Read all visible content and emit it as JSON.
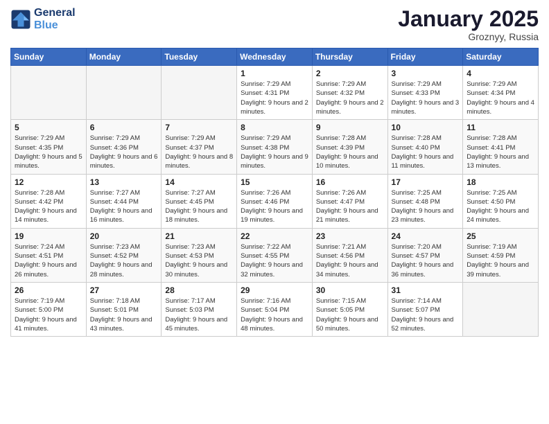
{
  "header": {
    "logo_line1": "General",
    "logo_line2": "Blue",
    "month": "January 2025",
    "location": "Groznyy, Russia"
  },
  "weekdays": [
    "Sunday",
    "Monday",
    "Tuesday",
    "Wednesday",
    "Thursday",
    "Friday",
    "Saturday"
  ],
  "weeks": [
    [
      {
        "day": "",
        "info": ""
      },
      {
        "day": "",
        "info": ""
      },
      {
        "day": "",
        "info": ""
      },
      {
        "day": "1",
        "info": "Sunrise: 7:29 AM\nSunset: 4:31 PM\nDaylight: 9 hours and 2 minutes."
      },
      {
        "day": "2",
        "info": "Sunrise: 7:29 AM\nSunset: 4:32 PM\nDaylight: 9 hours and 2 minutes."
      },
      {
        "day": "3",
        "info": "Sunrise: 7:29 AM\nSunset: 4:33 PM\nDaylight: 9 hours and 3 minutes."
      },
      {
        "day": "4",
        "info": "Sunrise: 7:29 AM\nSunset: 4:34 PM\nDaylight: 9 hours and 4 minutes."
      }
    ],
    [
      {
        "day": "5",
        "info": "Sunrise: 7:29 AM\nSunset: 4:35 PM\nDaylight: 9 hours and 5 minutes."
      },
      {
        "day": "6",
        "info": "Sunrise: 7:29 AM\nSunset: 4:36 PM\nDaylight: 9 hours and 6 minutes."
      },
      {
        "day": "7",
        "info": "Sunrise: 7:29 AM\nSunset: 4:37 PM\nDaylight: 9 hours and 8 minutes."
      },
      {
        "day": "8",
        "info": "Sunrise: 7:29 AM\nSunset: 4:38 PM\nDaylight: 9 hours and 9 minutes."
      },
      {
        "day": "9",
        "info": "Sunrise: 7:28 AM\nSunset: 4:39 PM\nDaylight: 9 hours and 10 minutes."
      },
      {
        "day": "10",
        "info": "Sunrise: 7:28 AM\nSunset: 4:40 PM\nDaylight: 9 hours and 11 minutes."
      },
      {
        "day": "11",
        "info": "Sunrise: 7:28 AM\nSunset: 4:41 PM\nDaylight: 9 hours and 13 minutes."
      }
    ],
    [
      {
        "day": "12",
        "info": "Sunrise: 7:28 AM\nSunset: 4:42 PM\nDaylight: 9 hours and 14 minutes."
      },
      {
        "day": "13",
        "info": "Sunrise: 7:27 AM\nSunset: 4:44 PM\nDaylight: 9 hours and 16 minutes."
      },
      {
        "day": "14",
        "info": "Sunrise: 7:27 AM\nSunset: 4:45 PM\nDaylight: 9 hours and 18 minutes."
      },
      {
        "day": "15",
        "info": "Sunrise: 7:26 AM\nSunset: 4:46 PM\nDaylight: 9 hours and 19 minutes."
      },
      {
        "day": "16",
        "info": "Sunrise: 7:26 AM\nSunset: 4:47 PM\nDaylight: 9 hours and 21 minutes."
      },
      {
        "day": "17",
        "info": "Sunrise: 7:25 AM\nSunset: 4:48 PM\nDaylight: 9 hours and 23 minutes."
      },
      {
        "day": "18",
        "info": "Sunrise: 7:25 AM\nSunset: 4:50 PM\nDaylight: 9 hours and 24 minutes."
      }
    ],
    [
      {
        "day": "19",
        "info": "Sunrise: 7:24 AM\nSunset: 4:51 PM\nDaylight: 9 hours and 26 minutes."
      },
      {
        "day": "20",
        "info": "Sunrise: 7:23 AM\nSunset: 4:52 PM\nDaylight: 9 hours and 28 minutes."
      },
      {
        "day": "21",
        "info": "Sunrise: 7:23 AM\nSunset: 4:53 PM\nDaylight: 9 hours and 30 minutes."
      },
      {
        "day": "22",
        "info": "Sunrise: 7:22 AM\nSunset: 4:55 PM\nDaylight: 9 hours and 32 minutes."
      },
      {
        "day": "23",
        "info": "Sunrise: 7:21 AM\nSunset: 4:56 PM\nDaylight: 9 hours and 34 minutes."
      },
      {
        "day": "24",
        "info": "Sunrise: 7:20 AM\nSunset: 4:57 PM\nDaylight: 9 hours and 36 minutes."
      },
      {
        "day": "25",
        "info": "Sunrise: 7:19 AM\nSunset: 4:59 PM\nDaylight: 9 hours and 39 minutes."
      }
    ],
    [
      {
        "day": "26",
        "info": "Sunrise: 7:19 AM\nSunset: 5:00 PM\nDaylight: 9 hours and 41 minutes."
      },
      {
        "day": "27",
        "info": "Sunrise: 7:18 AM\nSunset: 5:01 PM\nDaylight: 9 hours and 43 minutes."
      },
      {
        "day": "28",
        "info": "Sunrise: 7:17 AM\nSunset: 5:03 PM\nDaylight: 9 hours and 45 minutes."
      },
      {
        "day": "29",
        "info": "Sunrise: 7:16 AM\nSunset: 5:04 PM\nDaylight: 9 hours and 48 minutes."
      },
      {
        "day": "30",
        "info": "Sunrise: 7:15 AM\nSunset: 5:05 PM\nDaylight: 9 hours and 50 minutes."
      },
      {
        "day": "31",
        "info": "Sunrise: 7:14 AM\nSunset: 5:07 PM\nDaylight: 9 hours and 52 minutes."
      },
      {
        "day": "",
        "info": ""
      }
    ]
  ]
}
